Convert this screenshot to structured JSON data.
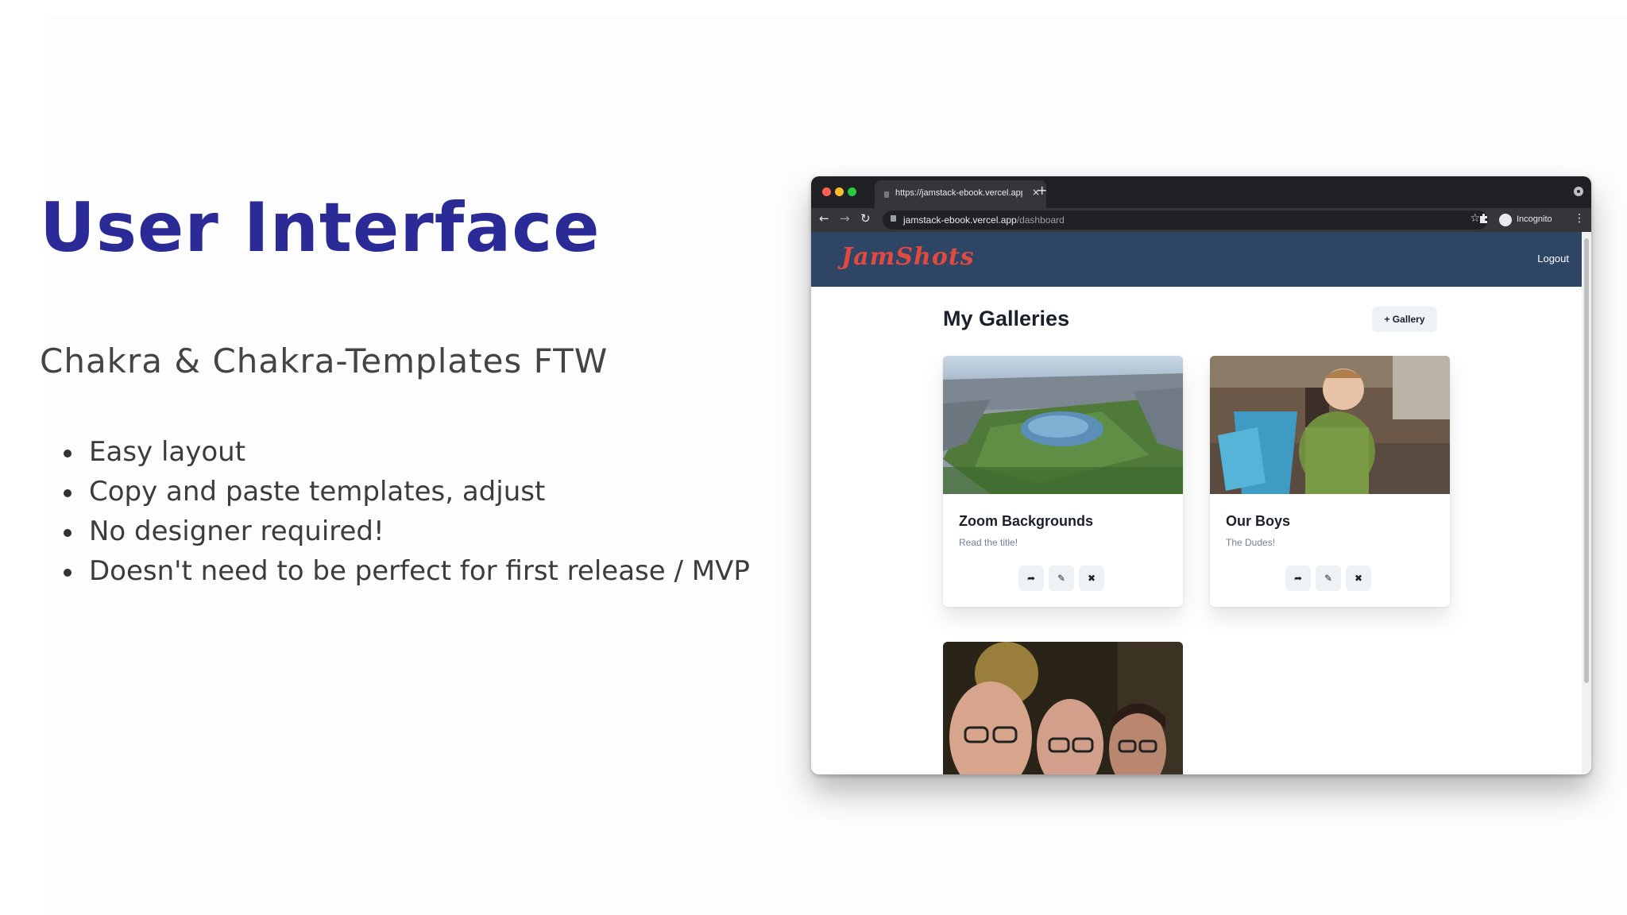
{
  "slide": {
    "title": "User Interface",
    "subtitle": "Chakra & Chakra-Templates FTW",
    "bullets": [
      "Easy layout",
      "Copy and paste templates, adjust",
      "No designer required!",
      "Doesn't need to be perfect for first release / MVP"
    ]
  },
  "browser": {
    "tab_title": "https://jamstack-ebook.vercel.app",
    "tab_close": "×",
    "new_tab": "+",
    "url_host": "jamstack-ebook.vercel.app",
    "url_path": "/dashboard",
    "incognito_label": "Incognito",
    "nav_back": "←",
    "nav_forward": "→",
    "nav_reload": "↻",
    "star": "☆",
    "menu": "⋮"
  },
  "app": {
    "logo": "JamShots",
    "logout": "Logout",
    "page_title": "My Galleries",
    "add_gallery": "+ Gallery",
    "galleries": [
      {
        "title": "Zoom Backgrounds",
        "description": "Read the title!",
        "image": "aerial photo of city park with lake"
      },
      {
        "title": "Our Boys",
        "description": "The Dudes!",
        "image": "toddler in green striped shirt on deck"
      },
      {
        "title": "",
        "description": "",
        "image": "selfie of three smiling men"
      }
    ],
    "card_actions": {
      "share": "➦",
      "edit": "✎",
      "delete": "✖"
    }
  },
  "colors": {
    "title": "#2a2b96",
    "app_header": "#2e4566",
    "logo": "#e2493f",
    "browser_chrome": "#202124"
  }
}
